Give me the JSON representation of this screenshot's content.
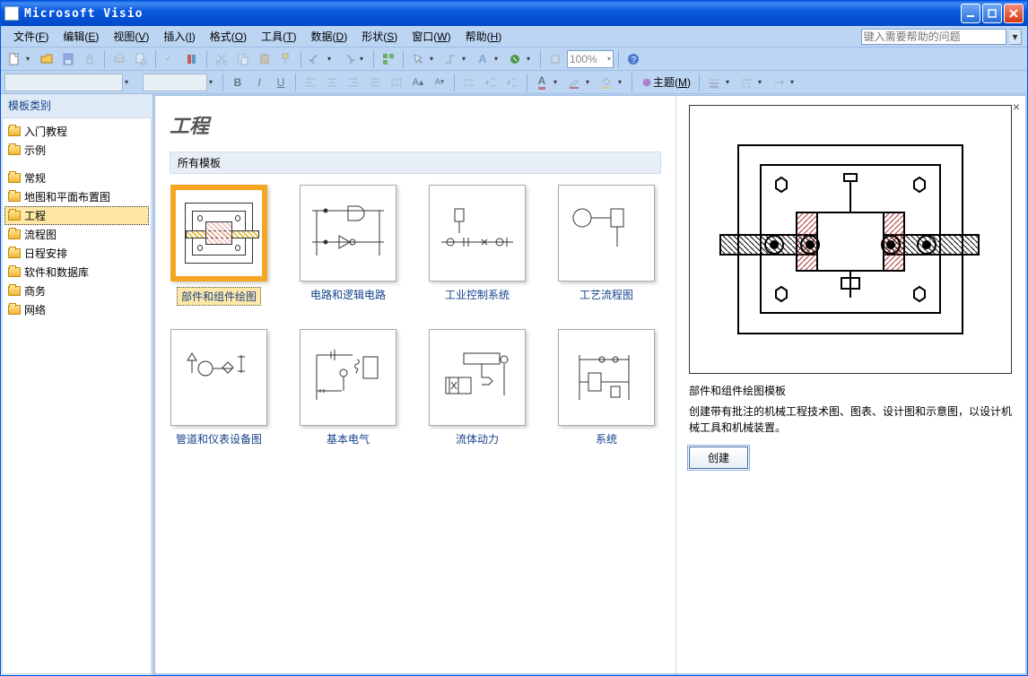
{
  "window": {
    "title": "Microsoft Visio"
  },
  "menu": [
    {
      "label": "文件",
      "accel": "F"
    },
    {
      "label": "编辑",
      "accel": "E"
    },
    {
      "label": "视图",
      "accel": "V"
    },
    {
      "label": "插入",
      "accel": "I"
    },
    {
      "label": "格式",
      "accel": "O"
    },
    {
      "label": "工具",
      "accel": "T"
    },
    {
      "label": "数据",
      "accel": "D"
    },
    {
      "label": "形状",
      "accel": "S"
    },
    {
      "label": "窗口",
      "accel": "W"
    },
    {
      "label": "帮助",
      "accel": "H"
    }
  ],
  "help_placeholder": "键入需要帮助的问题",
  "toolbar": {
    "zoom": "100%",
    "theme_label": "主题",
    "theme_accel": "M"
  },
  "format": {
    "font": "",
    "size": ""
  },
  "sidebar": {
    "title": "模板类别",
    "group1": [
      {
        "label": "入门教程"
      },
      {
        "label": "示例"
      }
    ],
    "group2": [
      {
        "label": "常规"
      },
      {
        "label": "地图和平面布置图"
      },
      {
        "label": "工程",
        "selected": true
      },
      {
        "label": "流程图"
      },
      {
        "label": "日程安排"
      },
      {
        "label": "软件和数据库"
      },
      {
        "label": "商务"
      },
      {
        "label": "网络"
      }
    ]
  },
  "page": {
    "title": "工程",
    "section": "所有模板"
  },
  "templates": [
    {
      "label": "部件和组件绘图",
      "selected": true
    },
    {
      "label": "电路和逻辑电路"
    },
    {
      "label": "工业控制系统"
    },
    {
      "label": "工艺流程图"
    },
    {
      "label": "管道和仪表设备图"
    },
    {
      "label": "基本电气"
    },
    {
      "label": "流体动力"
    },
    {
      "label": "系统"
    }
  ],
  "preview": {
    "title": "部件和组件绘图模板",
    "description": "创建带有批注的机械工程技术图、图表、设计图和示意图，以设计机械工具和机械装置。",
    "create_label": "创建"
  }
}
